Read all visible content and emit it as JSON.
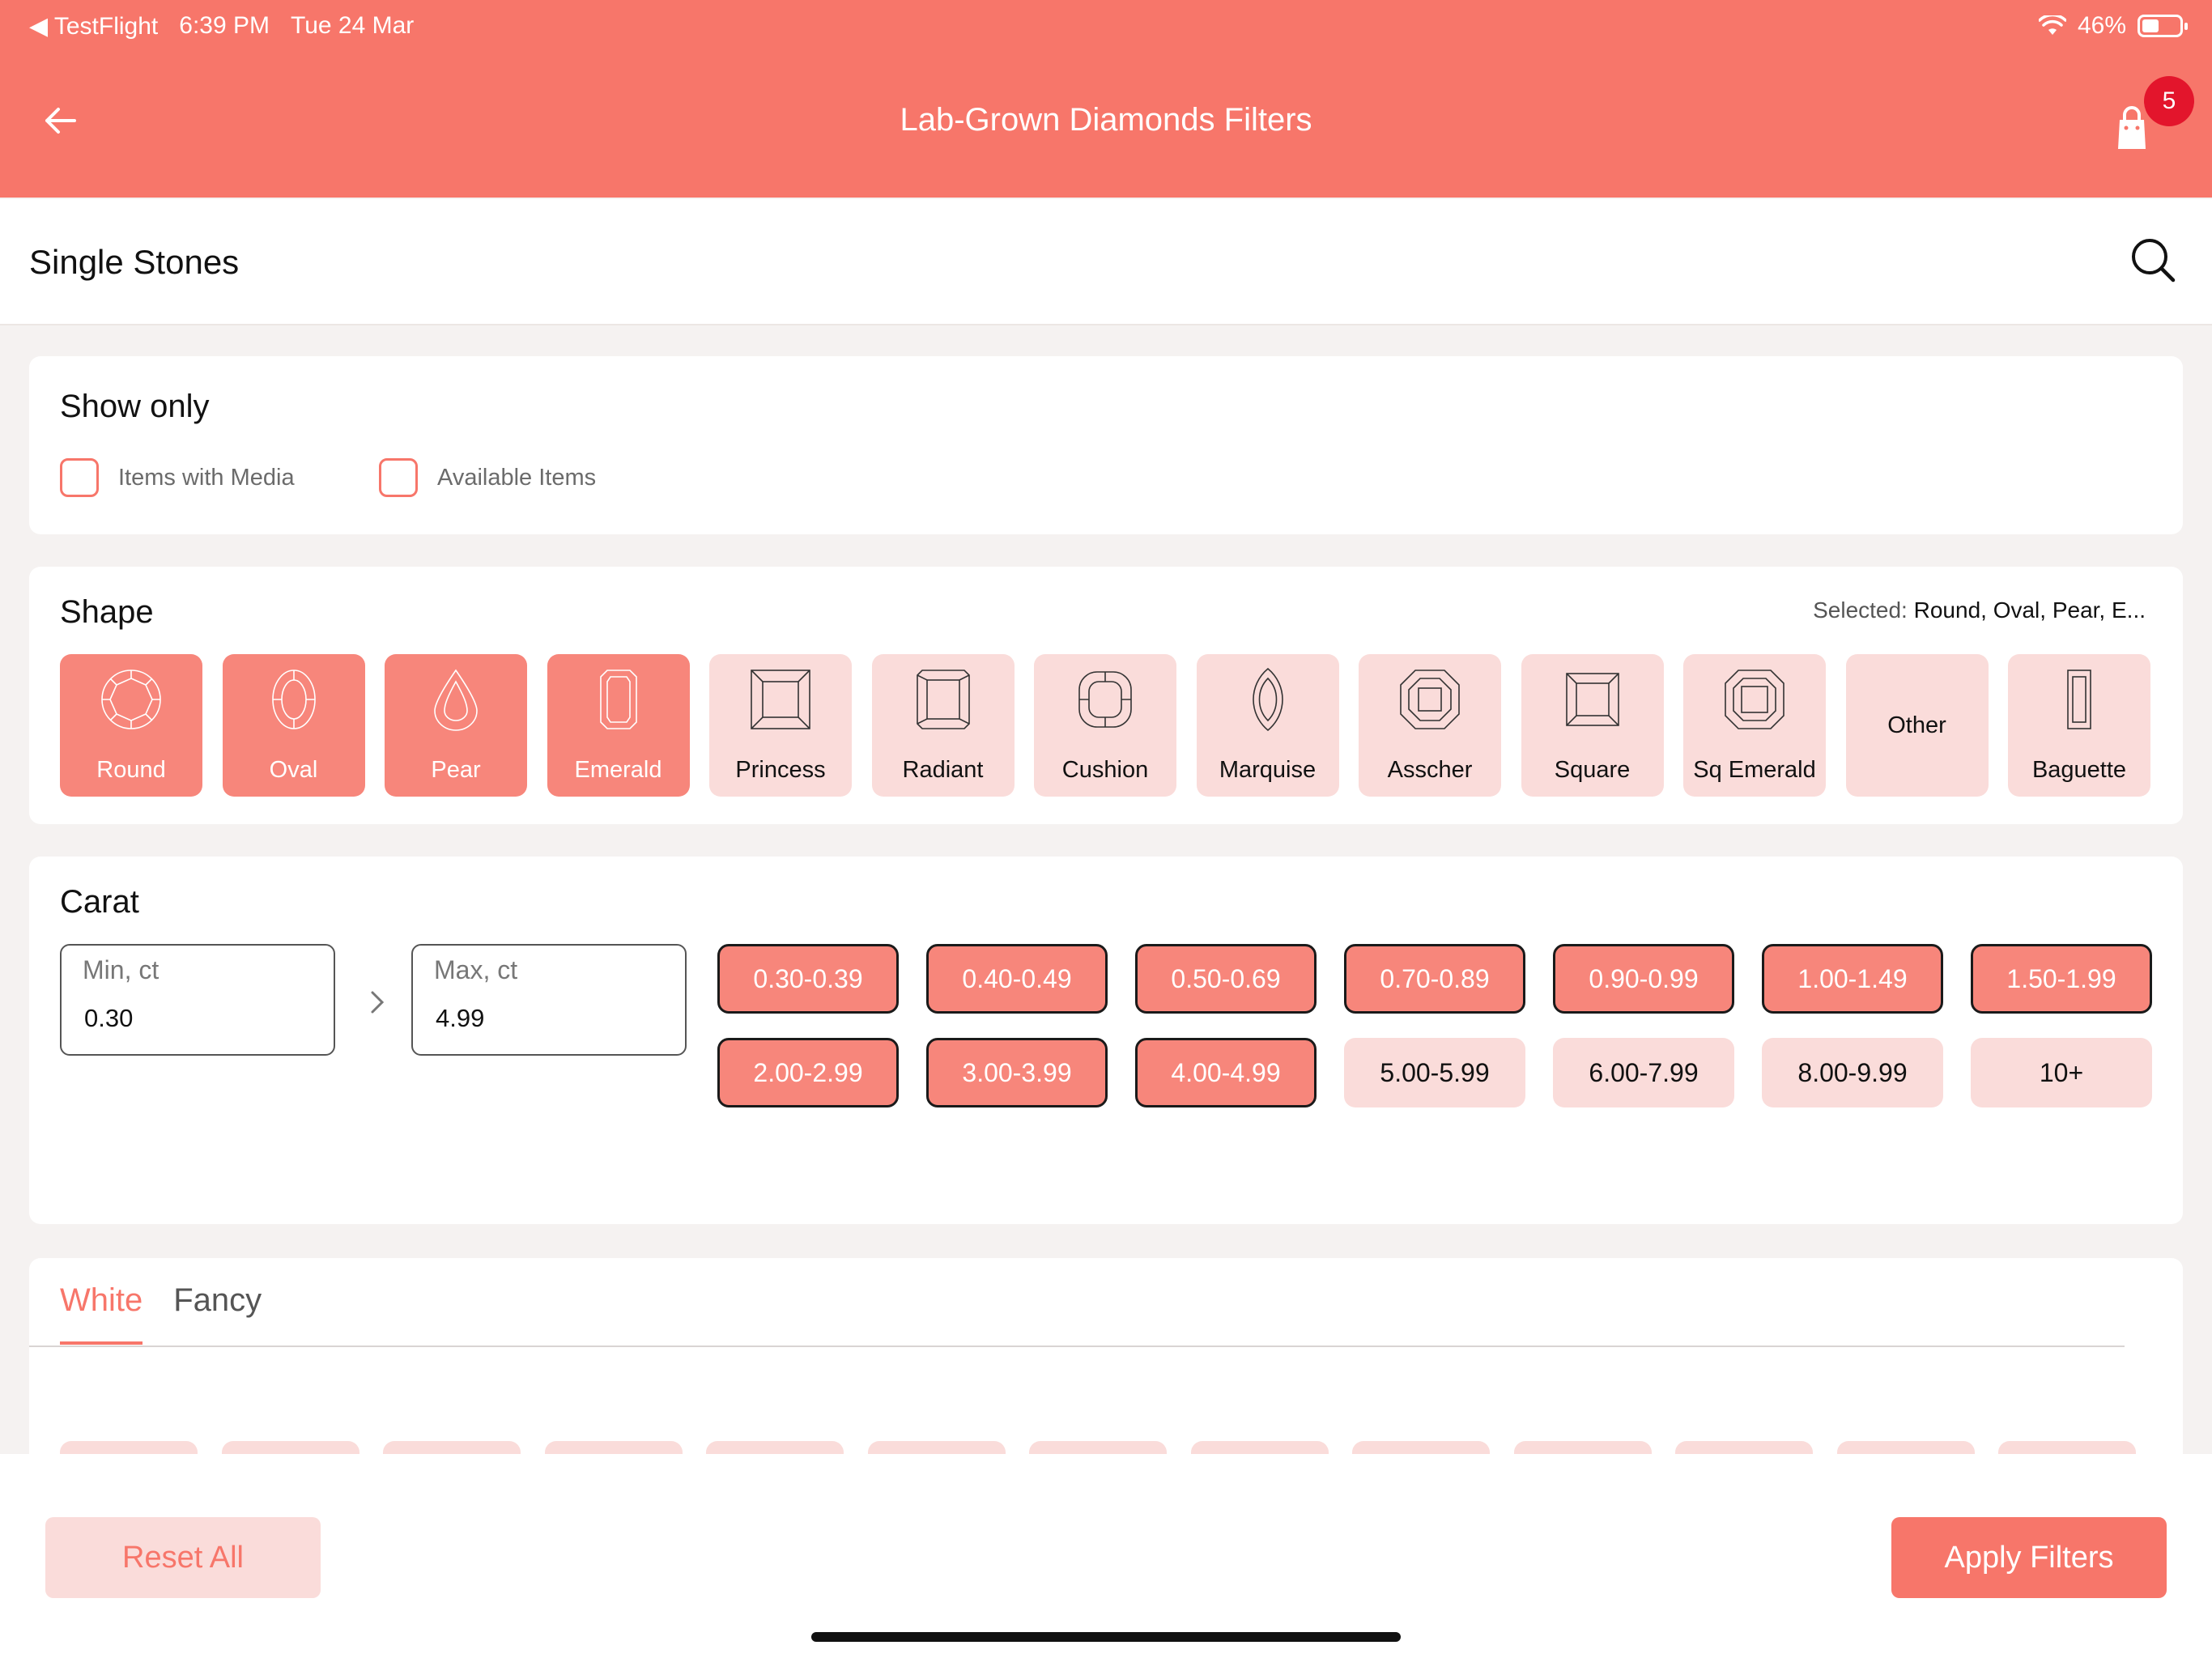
{
  "status_bar": {
    "back_app": "TestFlight",
    "time": "6:39 PM",
    "date": "Tue 24 Mar",
    "battery": "46%",
    "battery_level": 0.46
  },
  "nav": {
    "title": "Lab-Grown Diamonds Filters",
    "cart_count": "5"
  },
  "subheader": {
    "label": "Single Stones"
  },
  "show_only": {
    "title": "Show only",
    "options": [
      "Items with Media",
      "Available Items"
    ]
  },
  "shape": {
    "title": "Shape",
    "selected_label": "Selected:",
    "selected_value": "Round, Oval, Pear, E...",
    "items": [
      {
        "label": "Round",
        "selected": true
      },
      {
        "label": "Oval",
        "selected": true
      },
      {
        "label": "Pear",
        "selected": true
      },
      {
        "label": "Emerald",
        "selected": true
      },
      {
        "label": "Princess",
        "selected": false
      },
      {
        "label": "Radiant",
        "selected": false
      },
      {
        "label": "Cushion",
        "selected": false
      },
      {
        "label": "Marquise",
        "selected": false
      },
      {
        "label": "Asscher",
        "selected": false
      },
      {
        "label": "Square",
        "selected": false
      },
      {
        "label": "Sq Emerald",
        "selected": false
      },
      {
        "label": "Other",
        "selected": false
      },
      {
        "label": "Baguette",
        "selected": false
      }
    ]
  },
  "carat": {
    "title": "Carat",
    "min_placeholder": "Min, ct",
    "min_value": "0.30",
    "max_placeholder": "Max, ct",
    "max_value": "4.99",
    "ranges": [
      {
        "label": "0.30-0.39",
        "selected": true
      },
      {
        "label": "0.40-0.49",
        "selected": true
      },
      {
        "label": "0.50-0.69",
        "selected": true
      },
      {
        "label": "0.70-0.89",
        "selected": true
      },
      {
        "label": "0.90-0.99",
        "selected": true
      },
      {
        "label": "1.00-1.49",
        "selected": true
      },
      {
        "label": "1.50-1.99",
        "selected": true
      },
      {
        "label": "2.00-2.99",
        "selected": true
      },
      {
        "label": "3.00-3.99",
        "selected": true
      },
      {
        "label": "4.00-4.99",
        "selected": true
      },
      {
        "label": "5.00-5.99",
        "selected": false
      },
      {
        "label": "6.00-7.99",
        "selected": false
      },
      {
        "label": "8.00-9.99",
        "selected": false
      },
      {
        "label": "10+",
        "selected": false
      }
    ]
  },
  "color_tabs": {
    "tabs": [
      "White",
      "Fancy"
    ],
    "active": "White"
  },
  "footer": {
    "reset": "Reset All",
    "apply": "Apply Filters"
  },
  "colors": {
    "accent": "#f7766a",
    "selected_tile": "#f7867b",
    "unselected_tile": "#fadcda",
    "badge": "#e3152c"
  }
}
